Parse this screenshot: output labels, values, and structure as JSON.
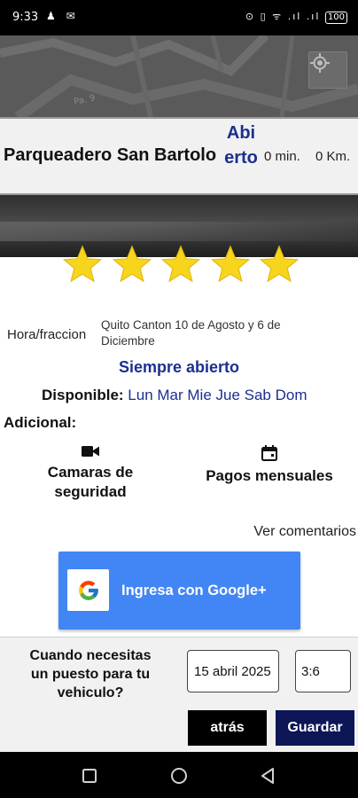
{
  "status_bar": {
    "time": "9:33",
    "left_icons": "♟ ✉",
    "right_icons": "⊙ ▯ ᯤ .ıl .ıl ",
    "battery": "100"
  },
  "map": {
    "street_label": "Pa. 9",
    "locate_icon": "gps-target-icon"
  },
  "header": {
    "name": "Parqueadero San Bartolo",
    "status": "Abierto",
    "minutes": "0 min.",
    "distance": "0 Km."
  },
  "rating": {
    "stars": 5,
    "max": 5,
    "color": "#f7d51d"
  },
  "details": {
    "rate_label": "Hora/fraccion",
    "address": "Quito Canton 10 de Agosto y 6 de Diciembre",
    "hours": "Siempre abierto",
    "available_label": "Disponible:",
    "days": "Lun Mar Mie Jue Sab Dom",
    "extra_label": "Adicional:"
  },
  "features": [
    {
      "label": "Camaras de seguridad",
      "icon": "video-camera-icon"
    },
    {
      "label": "Pagos mensuales",
      "icon": "calendar-icon"
    }
  ],
  "comments_link": "Ver comentarios",
  "google_button": {
    "label": "Ingresa con Google+",
    "color": "#4285f4"
  },
  "booking": {
    "question": "Cuando necesitas un puesto para tu vehiculo?",
    "date_value": "15  abril  2025",
    "time_value": "3:6",
    "back_label": "atrás",
    "save_label": "Guardar",
    "save_color": "#0d1656"
  },
  "nav": {
    "recents": "square-icon",
    "home": "circle-icon",
    "back": "triangle-back-icon"
  }
}
